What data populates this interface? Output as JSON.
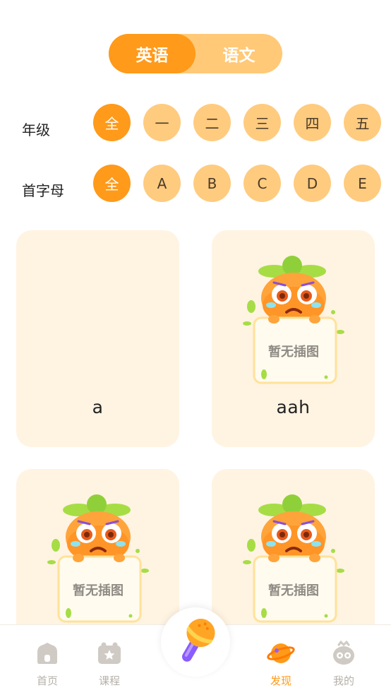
{
  "tabs": [
    {
      "label": "英语",
      "active": true
    },
    {
      "label": "语文",
      "active": false
    }
  ],
  "grade": {
    "label": "年级",
    "options": [
      "全",
      "一",
      "二",
      "三",
      "四",
      "五"
    ],
    "selected": "全"
  },
  "initial": {
    "label": "首字母",
    "options": [
      "全",
      "A",
      "B",
      "C",
      "D",
      "E"
    ],
    "selected": "全"
  },
  "cards": [
    {
      "word": "a",
      "has_image": false
    },
    {
      "word": "aah",
      "has_image": true,
      "placeholder": "暂无插图"
    },
    {
      "word": "",
      "has_image": true,
      "placeholder": "暂无插图"
    },
    {
      "word": "",
      "has_image": true,
      "placeholder": "暂无插图"
    }
  ],
  "nav": {
    "home": "首页",
    "courses": "课程",
    "discover": "发现",
    "mine": "我的",
    "active": "discover"
  },
  "colors": {
    "accent": "#ff9a1a",
    "chip": "#ffcb7f",
    "card_bg": "#fff3e2",
    "inactive_nav": "#b6b0a9"
  }
}
